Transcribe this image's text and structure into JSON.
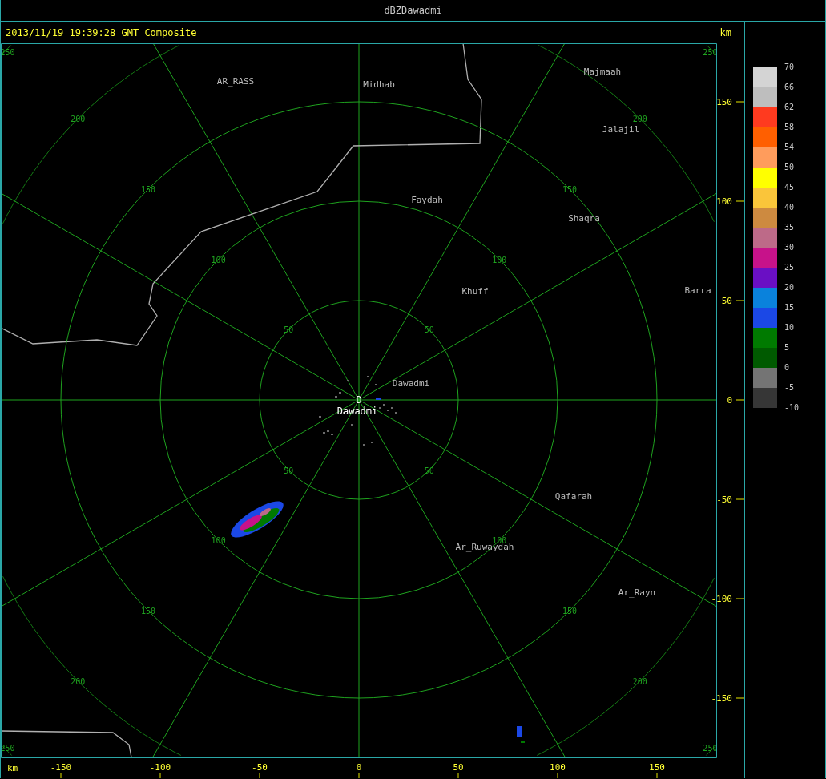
{
  "window": {
    "title": "dBZDawadmi"
  },
  "header": {
    "timestamp": "2013/11/19 19:39:28 GMT Composite",
    "unit": "km"
  },
  "range_rings": [
    {
      "labels": [
        "50",
        "50",
        "50",
        "50"
      ]
    },
    {
      "labels": [
        "100",
        "100",
        "100",
        "100"
      ]
    },
    {
      "labels": [
        "150",
        "150",
        "150",
        "150"
      ]
    },
    {
      "labels": [
        "200",
        "200",
        "200",
        "200"
      ]
    },
    {
      "labels": [
        "250",
        "250",
        "250",
        "250"
      ]
    }
  ],
  "places": [
    {
      "name": "AR_RASS",
      "kind": "city"
    },
    {
      "name": "Midhab",
      "kind": "city"
    },
    {
      "name": "Majmaah",
      "kind": "city"
    },
    {
      "name": "Jalajil",
      "kind": "city"
    },
    {
      "name": "Faydah",
      "kind": "city"
    },
    {
      "name": "Shaqra",
      "kind": "city"
    },
    {
      "name": "Khuff",
      "kind": "city"
    },
    {
      "name": "Barra",
      "kind": "city"
    },
    {
      "name": "Dawadmi",
      "kind": "city"
    },
    {
      "name": "D",
      "kind": "radar"
    },
    {
      "name": "Dawadmi",
      "kind": "radar"
    },
    {
      "name": "Qafarah",
      "kind": "city"
    },
    {
      "name": "Ar_Ruwaydah",
      "kind": "city"
    },
    {
      "name": "Ar_Rayn",
      "kind": "city"
    }
  ],
  "x_axis": {
    "unit": "km",
    "ticks": [
      "-150",
      "-100",
      "-50",
      "0",
      "50",
      "100",
      "150"
    ]
  },
  "y_axis": {
    "ticks": [
      "150",
      "100",
      "50",
      "0",
      "-50",
      "-100",
      "-150"
    ]
  },
  "color_scale": {
    "bins": [
      {
        "label": "70",
        "color": "#d4d4d4"
      },
      {
        "label": "66",
        "color": "#bebebe"
      },
      {
        "label": "62",
        "color": "#ff3a1f"
      },
      {
        "label": "58",
        "color": "#ff5f00"
      },
      {
        "label": "54",
        "color": "#ff9c5c"
      },
      {
        "label": "50",
        "color": "#ffff00"
      },
      {
        "label": "45",
        "color": "#fac53a"
      },
      {
        "label": "40",
        "color": "#cd8a40"
      },
      {
        "label": "35",
        "color": "#bd6a88"
      },
      {
        "label": "30",
        "color": "#c7128a"
      },
      {
        "label": "25",
        "color": "#6a0fc4"
      },
      {
        "label": "20",
        "color": "#0a82dc"
      },
      {
        "label": "15",
        "color": "#1b48e6"
      },
      {
        "label": "10",
        "color": "#007a00"
      },
      {
        "label": "5",
        "color": "#005a00"
      },
      {
        "label": "0",
        "color": "#747474"
      },
      {
        "label": "-5",
        "color": "#363636"
      }
    ],
    "bottom_label": "-10"
  }
}
